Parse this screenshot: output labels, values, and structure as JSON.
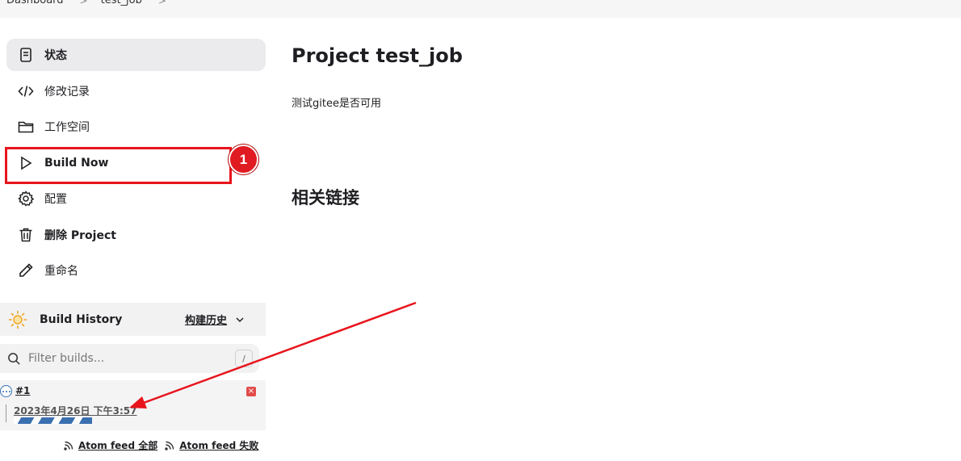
{
  "breadcrumb": {
    "items": [
      "Dashboard",
      "test_job"
    ]
  },
  "sidebar": {
    "tasks": [
      {
        "label": "状态",
        "icon": "document-icon"
      },
      {
        "label": "修改记录",
        "icon": "code-icon"
      },
      {
        "label": "工作空间",
        "icon": "folder-icon"
      },
      {
        "label": "Build Now",
        "icon": "play-icon"
      },
      {
        "label": "配置",
        "icon": "gear-icon"
      },
      {
        "label": "删除 Project",
        "icon": "trash-icon"
      },
      {
        "label": "重命名",
        "icon": "pencil-icon"
      }
    ]
  },
  "annotation": {
    "badge_number": "1",
    "color": "#e8141c"
  },
  "build_history": {
    "title": "Build History",
    "trend_label": "构建历史",
    "filter_placeholder": "Filter builds...",
    "filter_shortcut": "/",
    "builds": [
      {
        "number": "#1",
        "date": "2023年4月26日 下午3:57",
        "status": "in-progress"
      }
    ],
    "feeds": [
      "Atom feed 全部",
      "Atom feed 失败"
    ]
  },
  "main": {
    "title": "Project test_job",
    "description": "测试gitee是否可用",
    "related_links_heading": "相关链接"
  },
  "colors": {
    "accent": "#3670b5",
    "highlight": "#e8141c"
  }
}
